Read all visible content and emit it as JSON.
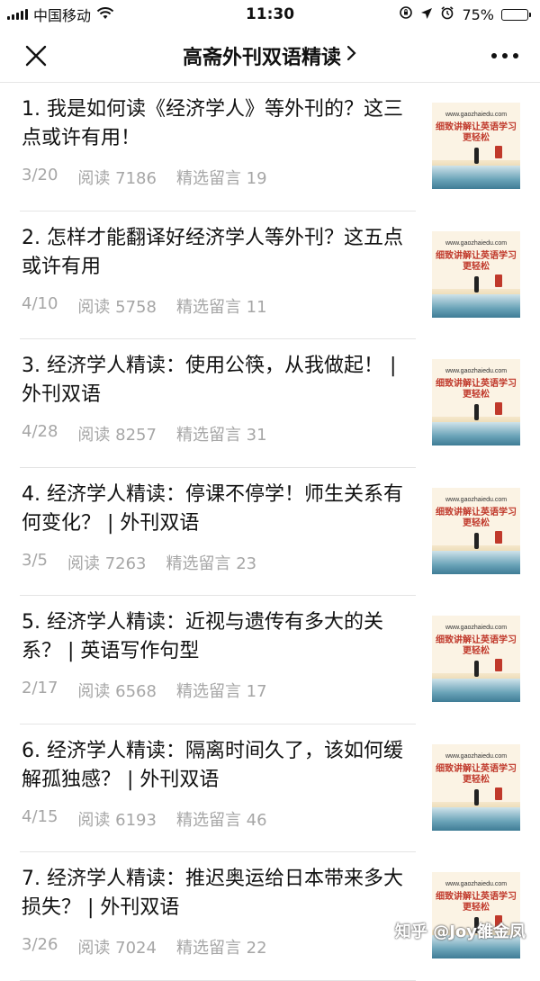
{
  "status_bar": {
    "carrier": "中国移动",
    "time": "11:30",
    "battery_percent": "75%",
    "battery_level": 0.75
  },
  "nav": {
    "title": "高斋外刊双语精读"
  },
  "articles": [
    {
      "title": "1. 我是如何读《经济学人》等外刊的？这三点或许有用！",
      "date": "3/20",
      "reads": "阅读 7186",
      "comments": "精选留言 19",
      "thumb_site": "www.gaozhaiedu.com",
      "thumb_line1": "细致讲解让英语学习",
      "thumb_line2": "更轻松"
    },
    {
      "title": "2. 怎样才能翻译好经济学人等外刊？这五点或许有用",
      "date": "4/10",
      "reads": "阅读 5758",
      "comments": "精选留言 11",
      "thumb_site": "www.gaozhaiedu.com",
      "thumb_line1": "细致讲解让英语学习",
      "thumb_line2": "更轻松"
    },
    {
      "title": "3. 经济学人精读：使用公筷，从我做起！ | 外刊双语",
      "date": "4/28",
      "reads": "阅读 8257",
      "comments": "精选留言 31",
      "thumb_site": "www.gaozhaiedu.com",
      "thumb_line1": "细致讲解让英语学习",
      "thumb_line2": "更轻松"
    },
    {
      "title": "4. 经济学人精读：停课不停学！师生关系有何变化？ | 外刊双语",
      "date": "3/5",
      "reads": "阅读 7263",
      "comments": "精选留言 23",
      "thumb_site": "www.gaozhaiedu.com",
      "thumb_line1": "细致讲解让英语学习",
      "thumb_line2": "更轻松"
    },
    {
      "title": "5. 经济学人精读：近视与遗传有多大的关系？ | 英语写作句型",
      "date": "2/17",
      "reads": "阅读 6568",
      "comments": "精选留言 17",
      "thumb_site": "www.gaozhaiedu.com",
      "thumb_line1": "细致讲解让英语学习",
      "thumb_line2": "更轻松"
    },
    {
      "title": "6. 经济学人精读：隔离时间久了，该如何缓解孤独感？ | 外刊双语",
      "date": "4/15",
      "reads": "阅读 6193",
      "comments": "精选留言 46",
      "thumb_site": "www.gaozhaiedu.com",
      "thumb_line1": "细致讲解让英语学习",
      "thumb_line2": "更轻松"
    },
    {
      "title": "7. 经济学人精读：推迟奥运给日本带来多大损失？ | 外刊双语",
      "date": "3/26",
      "reads": "阅读 7024",
      "comments": "精选留言 22",
      "thumb_site": "www.gaozhaiedu.com",
      "thumb_line1": "细致讲解让英语学习",
      "thumb_line2": "更轻松"
    }
  ],
  "watermark": "知乎 @Joy雒金凤",
  "colors": {
    "meta_text": "#a6a6a6",
    "divider": "#e4e4e4",
    "thumb_red": "#c0392b"
  }
}
